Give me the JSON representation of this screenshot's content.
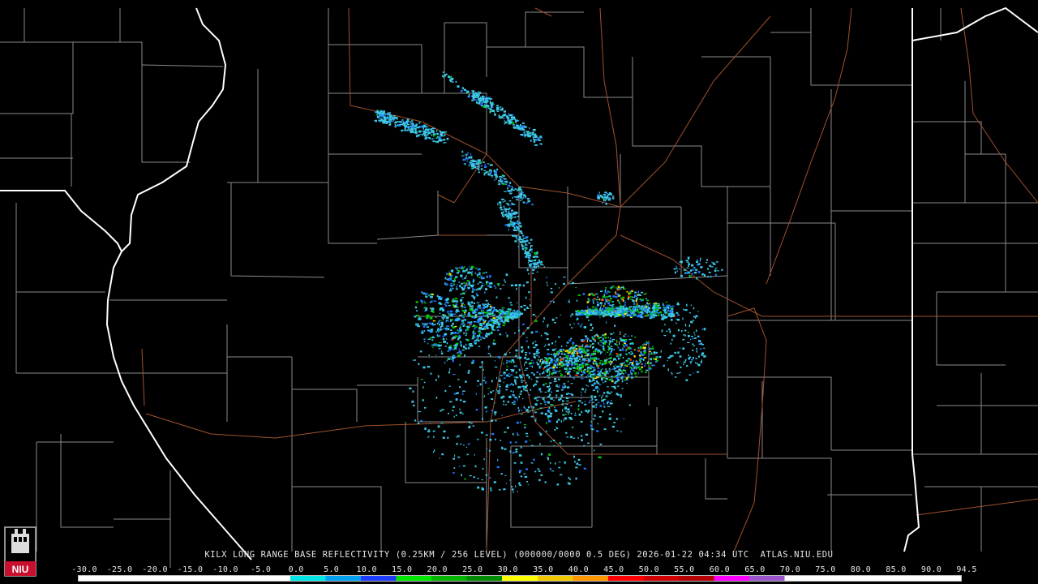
{
  "product": {
    "caption": "KILX LONG RANGE BASE REFLECTIVITY (0.25KM / 256 LEVEL) (000000/0000 0.5 DEG) 2026-01-22 04:34 UTC  ATLAS.NIU.EDU"
  },
  "logo": {
    "text": "NIU",
    "accent": "#c8102e"
  },
  "colorbar": {
    "labels": [
      "-30.0",
      "-25.0",
      "-20.0",
      "-15.0",
      "-10.0",
      "-5.0",
      "0.0",
      "5.0",
      "10.0",
      "15.0",
      "20.0",
      "25.0",
      "30.0",
      "35.0",
      "40.0",
      "45.0",
      "50.0",
      "55.0",
      "60.0",
      "65.0",
      "70.0",
      "75.0",
      "80.0",
      "85.0",
      "90.0",
      "94.5"
    ],
    "stops": [
      "#ffffff",
      "#ffffff",
      "#ffffff",
      "#ffffff",
      "#ffffff",
      "#ffffff",
      "#00e6e6",
      "#00a0f0",
      "#1e3cff",
      "#00e600",
      "#00b400",
      "#008c00",
      "#ffff00",
      "#f0c800",
      "#ff9600",
      "#ff0000",
      "#d20000",
      "#b40000",
      "#ff00ff",
      "#9955c9",
      "#ffffff",
      "#ffffff",
      "#ffffff",
      "#ffffff",
      "#ffffff"
    ]
  },
  "colors": {
    "background": "#000000",
    "county_lines": "#8a8a8a",
    "state_lines": "#ffffff",
    "highways": "#a0522d",
    "echo_light": "#3cc8e6",
    "echo_mid": "#1e78ff",
    "echo_moderate": "#00c800",
    "echo_heavy": "#ffe600",
    "echo_intense": "#ff3c00"
  }
}
